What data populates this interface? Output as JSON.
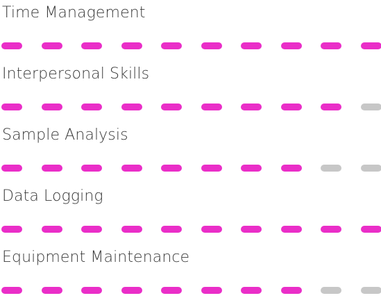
{
  "colors": {
    "filled": "#ea2ec8",
    "empty": "#c7c7c7",
    "text": "#3a3a3a"
  },
  "segments_total": 10,
  "skills": [
    {
      "name": "Time Management",
      "level": 10
    },
    {
      "name": "Interpersonal Skills",
      "level": 9
    },
    {
      "name": "Sample Analysis",
      "level": 8
    },
    {
      "name": "Data Logging",
      "level": 10
    },
    {
      "name": "Equipment Maintenance",
      "level": 8
    }
  ]
}
